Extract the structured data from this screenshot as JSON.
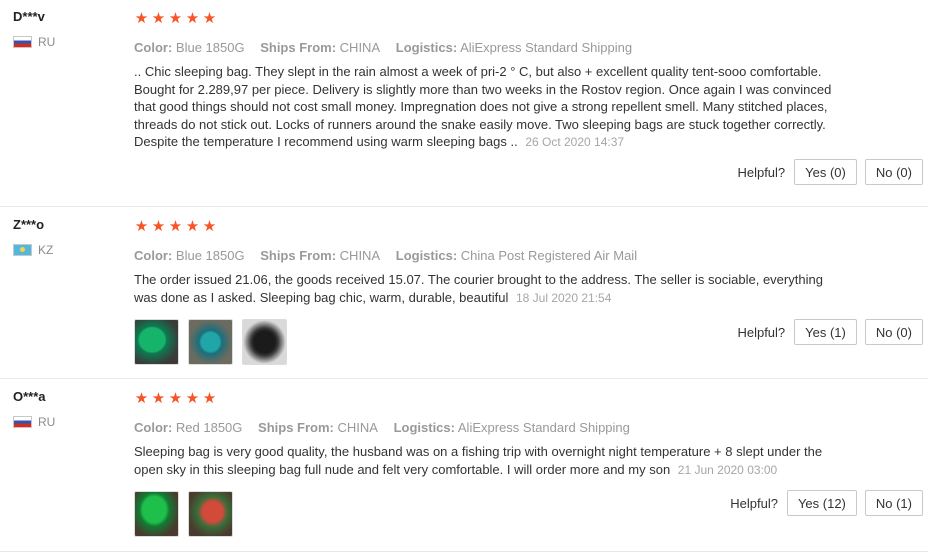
{
  "reviews": [
    {
      "user": "D***v",
      "country": "RU",
      "flag": "flag-ru",
      "rating": 5,
      "color_label": "Color:",
      "color_value": "Blue 1850G",
      "ships_label": "Ships From:",
      "ships_value": "CHINA",
      "logistics_label": "Logistics:",
      "logistics_value": "AliExpress Standard Shipping",
      "text": ".. Chic sleeping bag. They slept in the rain almost a week of pri-2 ° C, but also + excellent quality tent-sooo comfortable. Bought for 2.289,97 per piece. Delivery is slightly more than two weeks in the Rostov region. Once again I was convinced that good things should not cost small money. Impregnation does not give a strong repellent smell. Many stitched places, threads do not stick out. Locks of runners around the snake easily move. Two sleeping bags are stuck together correctly. Despite the temperature I recommend using warm sleeping bags ..",
      "date": "26 Oct 2020 14:37",
      "photos": [],
      "helpful_label": "Helpful?",
      "yes_label": "Yes (0)",
      "no_label": "No (0)"
    },
    {
      "user": "Z***o",
      "country": "KZ",
      "flag": "flag-kz",
      "rating": 5,
      "color_label": "Color:",
      "color_value": "Blue 1850G",
      "ships_label": "Ships From:",
      "ships_value": "CHINA",
      "logistics_label": "Logistics:",
      "logistics_value": "China Post Registered Air Mail",
      "text": "The order issued 21.06, the goods received 15.07. The courier brought to the address. The seller is sociable, everything was done as I asked. Sleeping bag chic, warm, durable, beautiful",
      "date": "18 Jul 2020 21:54",
      "photos": [
        "ph-a",
        "ph-b",
        "ph-c"
      ],
      "helpful_label": "Helpful?",
      "yes_label": "Yes (1)",
      "no_label": "No (0)"
    },
    {
      "user": "O***a",
      "country": "RU",
      "flag": "flag-ru",
      "rating": 5,
      "color_label": "Color:",
      "color_value": "Red 1850G",
      "ships_label": "Ships From:",
      "ships_value": "CHINA",
      "logistics_label": "Logistics:",
      "logistics_value": "AliExpress Standard Shipping",
      "text": "Sleeping bag is very good quality, the husband was on a fishing trip with overnight night temperature + 8 slept under the open sky in this sleeping bag full nude and felt very comfortable. I will order more and my son",
      "date": "21 Jun 2020 03:00",
      "photos": [
        "ph-d",
        "ph-e"
      ],
      "helpful_label": "Helpful?",
      "yes_label": "Yes (12)",
      "no_label": "No (1)"
    }
  ],
  "icons": {
    "star": "star-icon",
    "flag_ru": "russia-flag-icon",
    "flag_kz": "kazakhstan-flag-icon"
  },
  "colors": {
    "star": "#f55426",
    "meta": "#999999",
    "text": "#333333",
    "divider": "#e8e8e8"
  }
}
